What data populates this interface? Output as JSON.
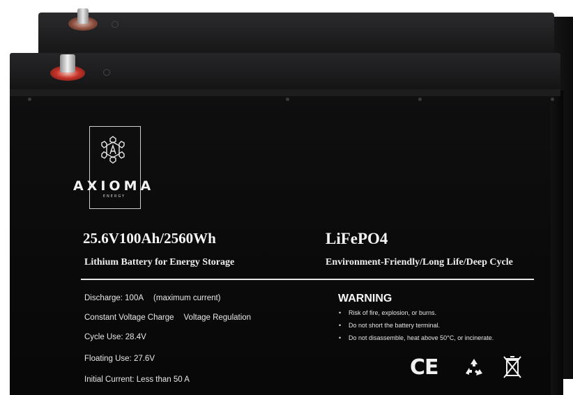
{
  "colors": {
    "case": "#0c0c0c",
    "lid": "#1f1f21",
    "text": "#f2f2f2",
    "terminal_positive": "#c7352b",
    "terminal_negative": "#7a3a2a",
    "bolt": "#c9c9c9"
  },
  "logo": {
    "brand": "AXIOMA",
    "sub": "ENERGY",
    "emblem_icon": "hexagon-star-emblem-icon"
  },
  "spec": {
    "rating": "25.6V100Ah/2560Wh",
    "description": "Lithium Battery for Energy Storage",
    "chemistry": "LiFePO4",
    "features": "Environment-Friendly/Long Life/Deep Cycle"
  },
  "details": [
    {
      "label": "Discharge:  100A",
      "note": "(maximum current)"
    },
    {
      "label": "Constant Voltage Charge",
      "note": "Voltage Regulation"
    },
    {
      "label": "Cycle Use: 28.4V",
      "note": ""
    },
    {
      "label": "Floating Use: 27.6V",
      "note": ""
    },
    {
      "label": "Initial Current: Less than 50 A",
      "note": ""
    }
  ],
  "warning": {
    "title": "WARNING",
    "items": [
      "Risk of fire, explosion, or burns.",
      "Do not short the battery terminal.",
      "Do not disassemble, heat above 50°C, or incinerate."
    ]
  },
  "certifications": {
    "ce": "CE",
    "recycle_icon": "recycle-icon",
    "bin_icon": "crossed-bin-icon"
  }
}
